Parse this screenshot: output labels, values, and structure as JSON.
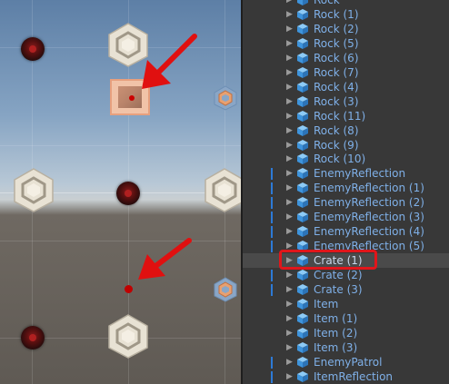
{
  "hierarchy": {
    "items": [
      {
        "label": "Rock",
        "marked": false
      },
      {
        "label": "Rock (1)",
        "marked": false
      },
      {
        "label": "Rock (2)",
        "marked": false
      },
      {
        "label": "Rock (5)",
        "marked": false
      },
      {
        "label": "Rock (6)",
        "marked": false
      },
      {
        "label": "Rock (7)",
        "marked": false
      },
      {
        "label": "Rock (4)",
        "marked": false
      },
      {
        "label": "Rock (3)",
        "marked": false
      },
      {
        "label": "Rock (11)",
        "marked": false
      },
      {
        "label": "Rock (8)",
        "marked": false
      },
      {
        "label": "Rock (9)",
        "marked": false
      },
      {
        "label": "Rock (10)",
        "marked": false
      },
      {
        "label": "EnemyReflection",
        "marked": true
      },
      {
        "label": "EnemyReflection (1)",
        "marked": true
      },
      {
        "label": "EnemyReflection (2)",
        "marked": true
      },
      {
        "label": "EnemyReflection (3)",
        "marked": true
      },
      {
        "label": "EnemyReflection (4)",
        "marked": true
      },
      {
        "label": "EnemyReflection (5)",
        "marked": true
      },
      {
        "label": "Crate (1)",
        "marked": false,
        "selected": true
      },
      {
        "label": "Crate (2)",
        "marked": true
      },
      {
        "label": "Crate (3)",
        "marked": true
      },
      {
        "label": "Item",
        "marked": false
      },
      {
        "label": "Item (1)",
        "marked": false
      },
      {
        "label": "Item (2)",
        "marked": false
      },
      {
        "label": "Item (3)",
        "marked": false
      },
      {
        "label": "EnemyPatrol",
        "marked": true
      },
      {
        "label": "ItemReflection",
        "marked": true
      }
    ]
  },
  "colors": {
    "label_blue": "#7fb0e8",
    "highlight_red": "#e0161b",
    "scene_marker_red": "#c00000",
    "prefab_cube_blue": "#4aa3e8"
  },
  "icons": {
    "expand": "triangle-right",
    "prefab": "cube",
    "scene_rock": "rock-hexagon",
    "scene_enemy": "red-sphere",
    "scene_gizmo": "hexagon-gizmo",
    "scene_arrow": "red-arrow"
  }
}
